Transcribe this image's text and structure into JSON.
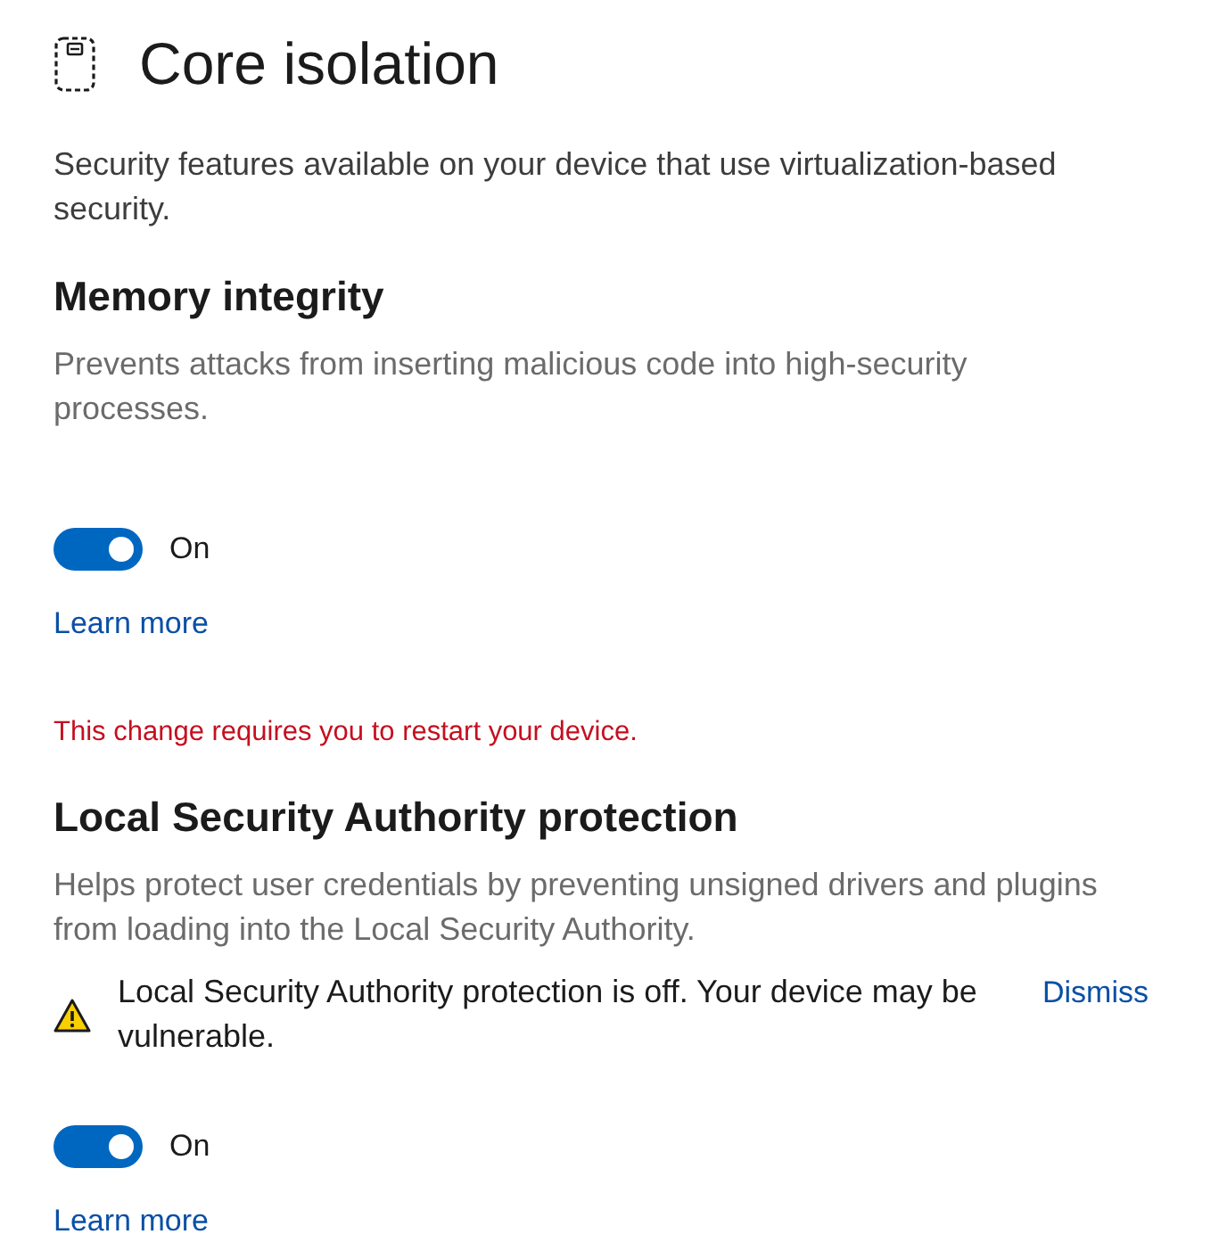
{
  "header": {
    "title": "Core isolation",
    "description": "Security features available on your device that use virtualization-based security."
  },
  "sections": [
    {
      "title": "Memory integrity",
      "description": "Prevents attacks from inserting malicious code into high-security processes.",
      "toggle": {
        "on": true,
        "label": "On"
      },
      "link": "Learn more",
      "restart_notice": "This change requires you to restart your device."
    },
    {
      "title": "Local Security Authority protection",
      "description": "Helps protect user credentials by preventing unsigned drivers and plugins from loading into the Local Security Authority.",
      "warning": {
        "text": "Local Security Authority protection is off. Your device may be vulnerable.",
        "action": "Dismiss"
      },
      "toggle": {
        "on": true,
        "label": "On"
      },
      "link": "Learn more"
    }
  ]
}
